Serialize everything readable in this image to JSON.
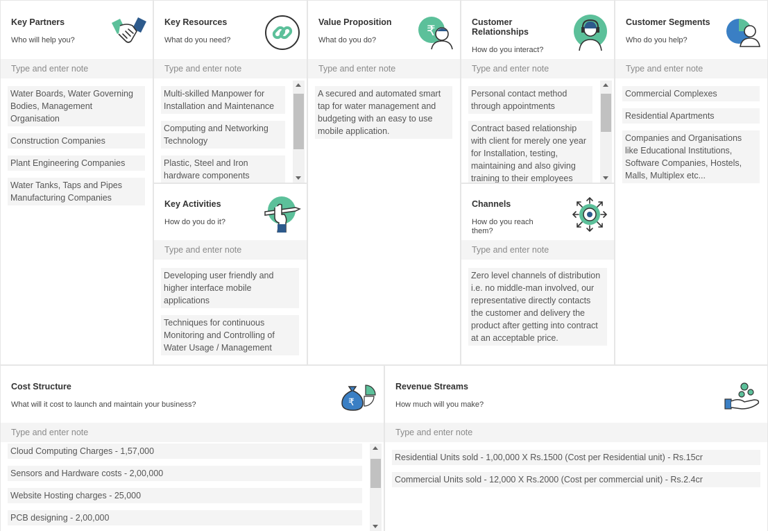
{
  "placeholder": "Type and enter note",
  "key_partners": {
    "title": "Key Partners",
    "subtitle": "Who will help you?",
    "icon": "handshake-icon",
    "notes": [
      "Water Boards, Water Governing Bodies, Management Organisation",
      "Construction Companies",
      "Plant Engineering Companies",
      "Water Tanks, Taps and Pipes Manufacturing Companies"
    ]
  },
  "key_resources": {
    "title": "Key Resources",
    "subtitle": "What do you need?",
    "icon": "chain-link-icon",
    "notes": [
      "Multi-skilled Manpower for Installation and Maintenance",
      "Computing and Networking Technology",
      "Plastic, Steel and Iron hardware components"
    ]
  },
  "key_activities": {
    "title": "Key Activities",
    "subtitle": "How do you do it?",
    "icon": "hand-pencil-icon",
    "notes": [
      "Developing user friendly and higher interface mobile applications",
      "Techniques for continuous Monitoring and Controlling of Water Usage / Management"
    ]
  },
  "value_proposition": {
    "title": "Value Proposition",
    "subtitle": "What do you do?",
    "icon": "rupee-person-icon",
    "notes": [
      "A secured and automated smart tap for water management and budgeting with an easy to use mobile application."
    ]
  },
  "customer_relationships": {
    "title": "Customer Relationships",
    "subtitle": "How do you interact?",
    "icon": "headset-agent-icon",
    "notes": [
      "Personal contact method through appointments",
      "Contract based relationship with client for merely one year for Installation, testing, maintaining and also giving training to their employees"
    ]
  },
  "channels": {
    "title": "Channels",
    "subtitle": "How do you reach them?",
    "icon": "target-arrows-icon",
    "notes": [
      "Zero level channels of distribution i.e. no middle-man involved, our representative directly contacts the customer and delivery the product after getting into contract at an acceptable price."
    ]
  },
  "customer_segments": {
    "title": "Customer Segments",
    "subtitle": "Who do you help?",
    "icon": "users-pie-icon",
    "notes": [
      "Commercial Complexes",
      "Residential Apartments",
      "Companies and Organisations like Educational Institutions, Software Companies, Hostels, Malls, Multiplex etc..."
    ]
  },
  "cost_structure": {
    "title": "Cost Structure",
    "subtitle": "What will it cost to launch and maintain your business?",
    "icon": "money-bag-pie-icon",
    "notes": [
      "Cloud Computing Charges - 1,57,000",
      "Sensors and Hardware costs - 2,00,000",
      "Website Hosting charges - 25,000",
      "PCB designing - 2,00,000"
    ]
  },
  "revenue_streams": {
    "title": "Revenue Streams",
    "subtitle": "How much will you make?",
    "icon": "hand-coins-icon",
    "notes": [
      "Residential Units sold - 1,00,000 X Rs.1500 (Cost per Residential unit) - Rs.15cr",
      "Commercial Units sold - 12,000 X Rs.2000 (Cost per commercial unit) - Rs.2.4cr"
    ]
  },
  "colors": {
    "accent_teal": "#5cc09a",
    "icon_navy": "#2d5a8c",
    "icon_blue": "#3a7fc4"
  }
}
